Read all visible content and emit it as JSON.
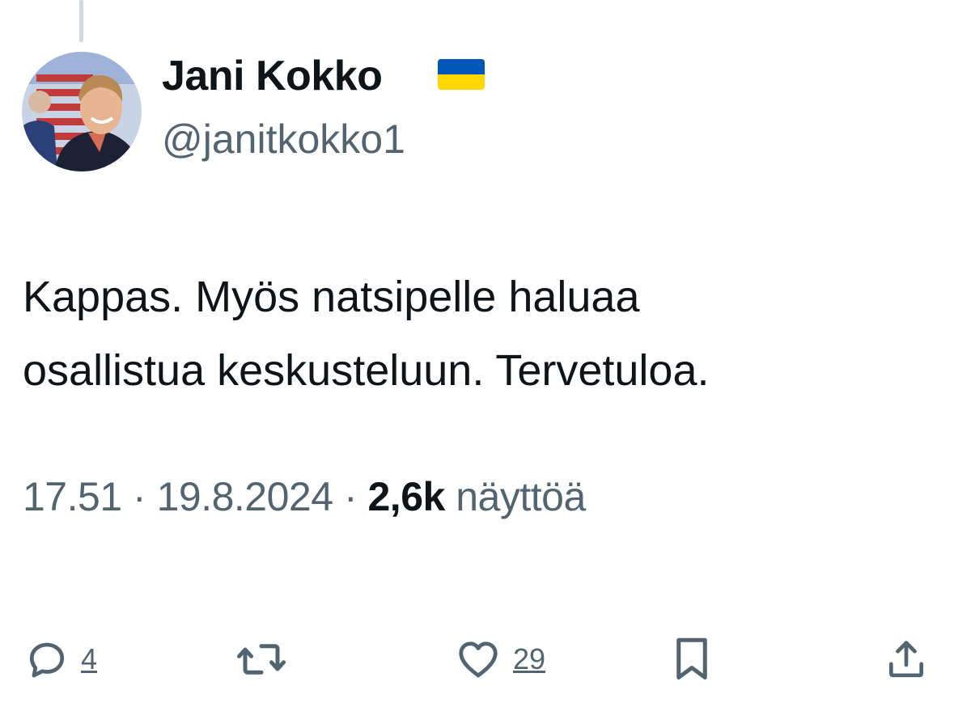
{
  "tweet": {
    "author": {
      "display_name": "Jani Kokko",
      "handle": "@janitkokko1",
      "name_emoji": "ukraine-flag"
    },
    "text_lines": [
      "Kappas. Myös natsipelle haluaa",
      "osallistua keskusteluun. Tervetuloa."
    ],
    "meta": {
      "time": "17.51",
      "separator": "·",
      "date": "19.8.2024",
      "views_count": "2,6k",
      "views_label": "näyttöä"
    },
    "actions": {
      "reply": {
        "icon": "reply-icon",
        "count": "4"
      },
      "retweet": {
        "icon": "retweet-icon",
        "count": ""
      },
      "like": {
        "icon": "heart-icon",
        "count": "29"
      },
      "bookmark": {
        "icon": "bookmark-icon"
      },
      "share": {
        "icon": "share-icon"
      }
    }
  },
  "colors": {
    "text_primary": "#0f1419",
    "text_secondary": "#536471",
    "flag_blue": "#0057b7",
    "flag_yellow": "#ffd700"
  }
}
